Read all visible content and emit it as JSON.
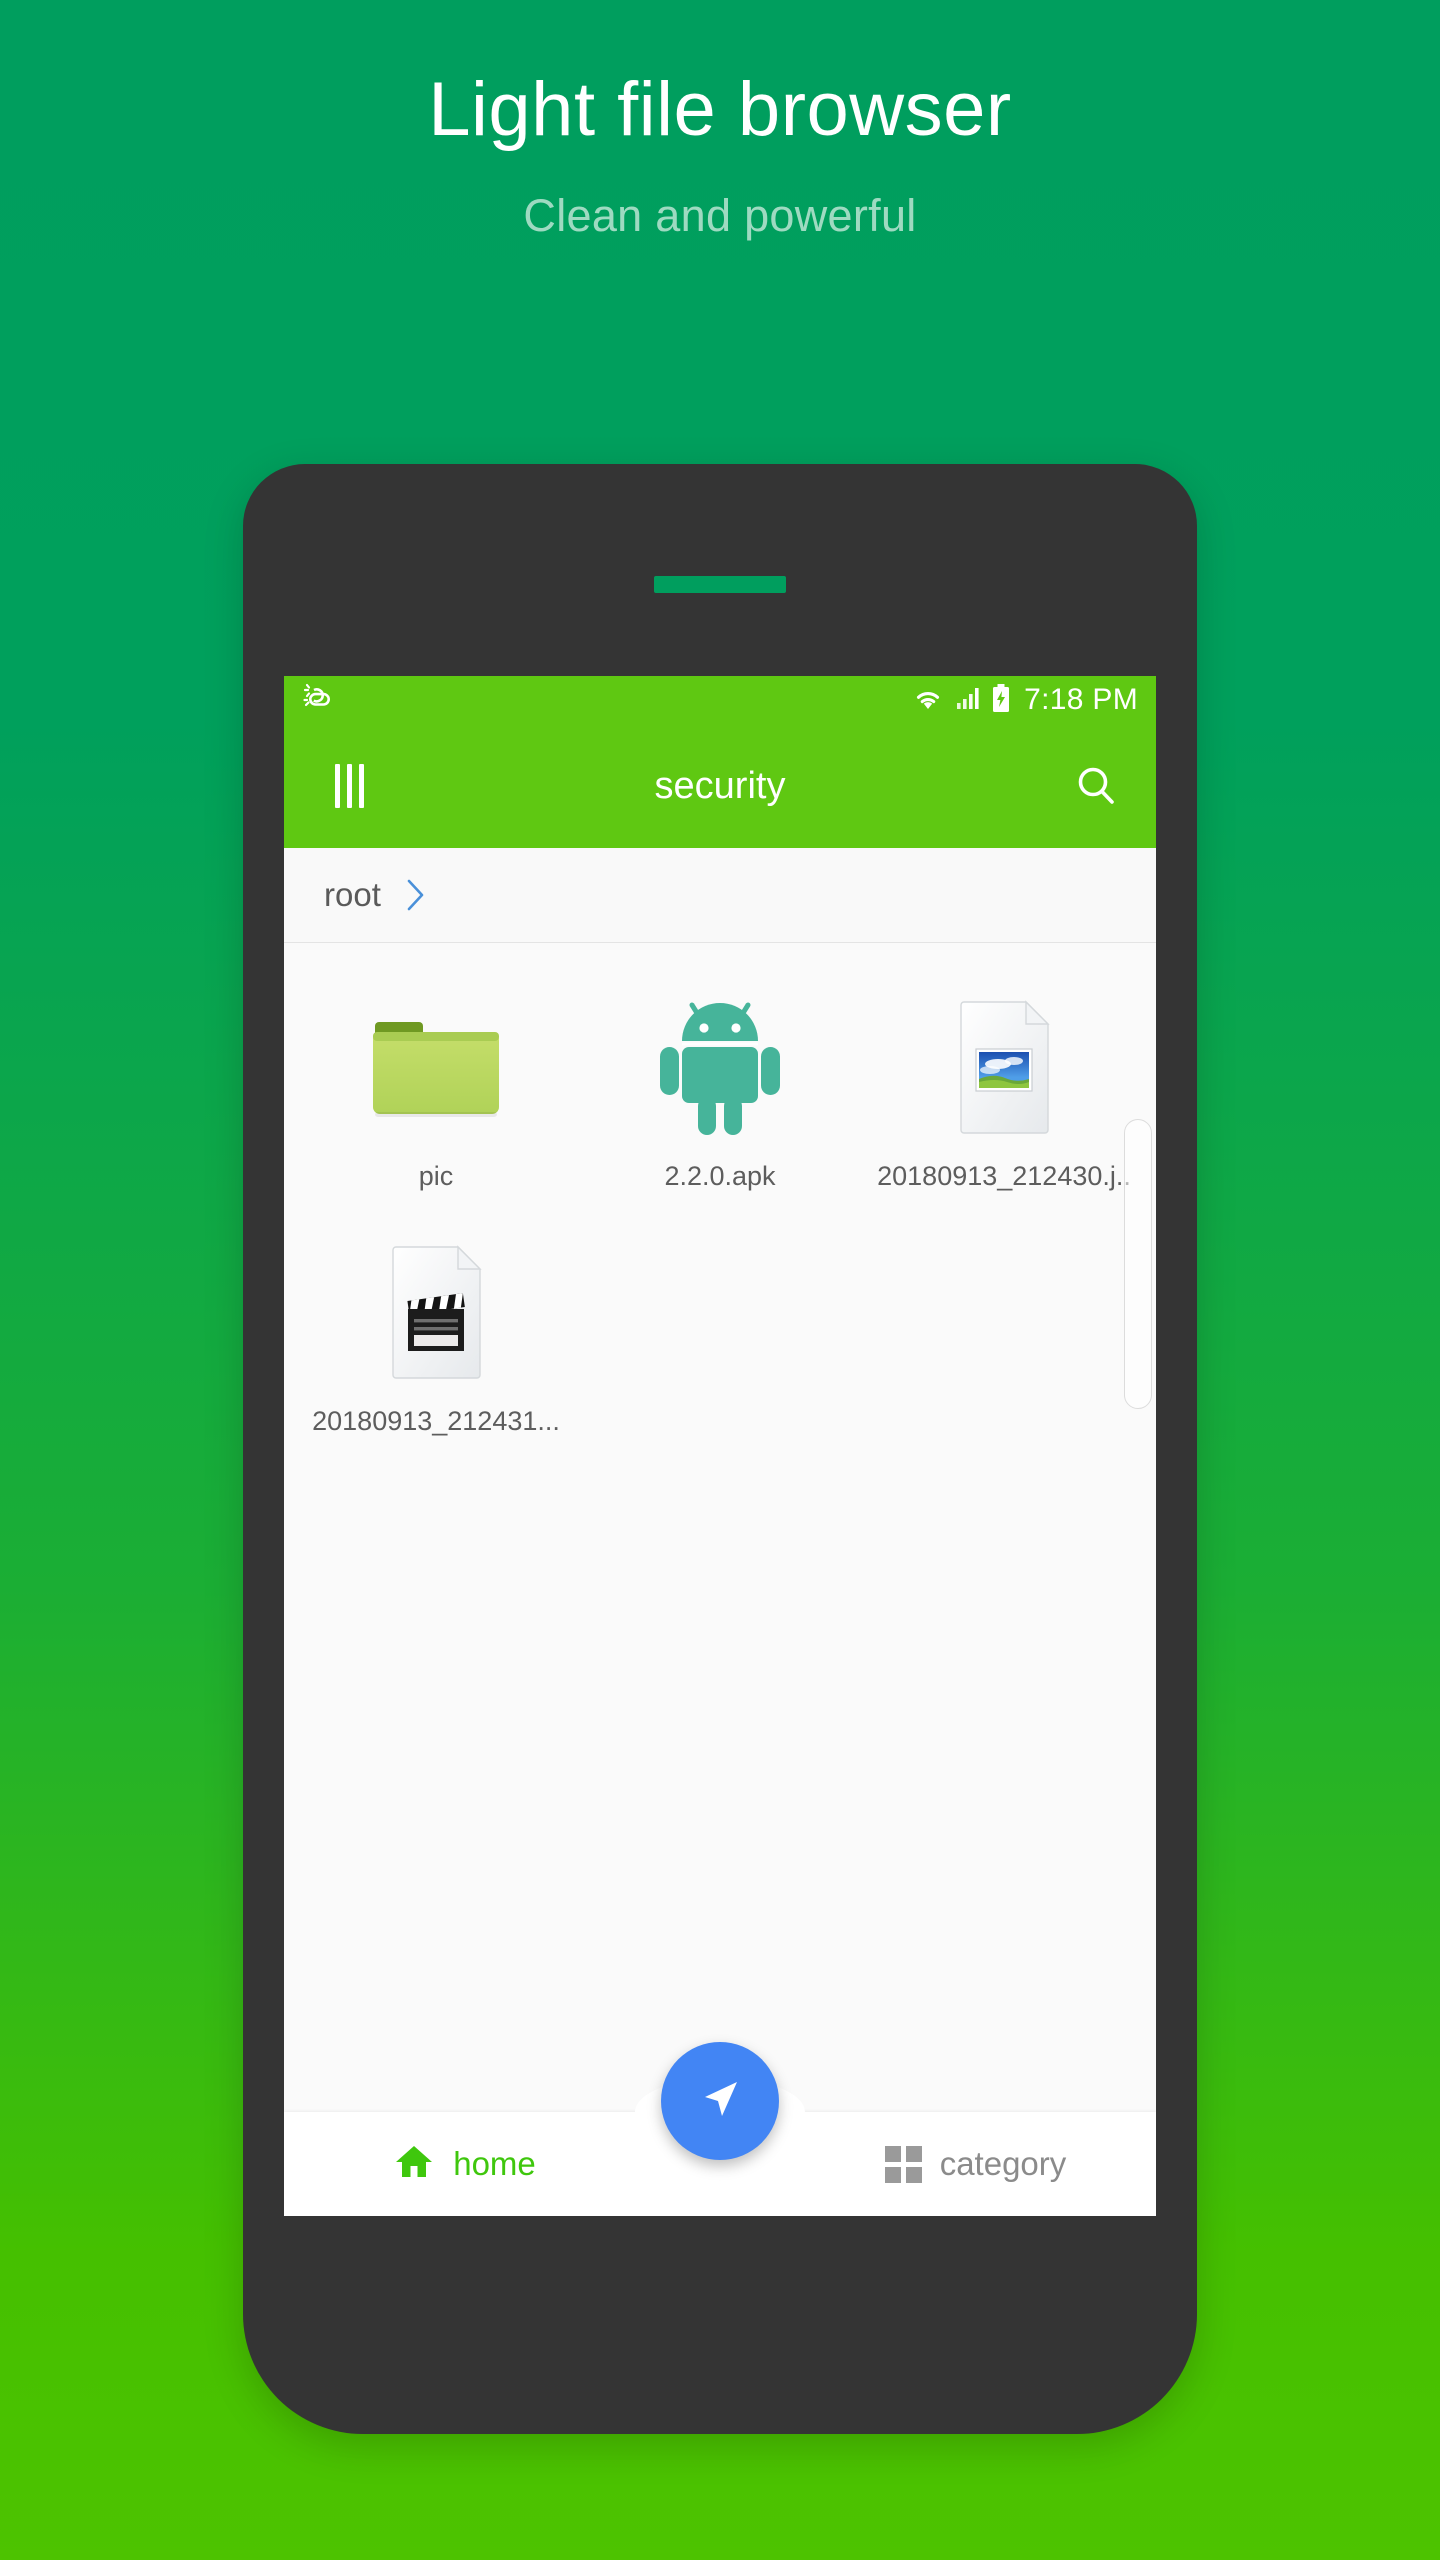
{
  "promo": {
    "title": "Light file browser",
    "subtitle": "Clean and powerful",
    "bg_top_color": "#009E5E",
    "bg_bottom_color": "#4DC300"
  },
  "phone": {
    "frame_color": "#343434",
    "speaker_color": "#009E5E"
  },
  "status_bar": {
    "weather_icon": "sun-cloud-icon",
    "wifi_icon": "wifi-icon",
    "signal_icon": "signal-bars-icon",
    "battery_icon": "battery-charging-icon",
    "time": "7:18 PM",
    "background_color": "#5FC812"
  },
  "app_bar": {
    "menu_icon": "menu-bars-icon",
    "title": "security",
    "search_icon": "search-icon",
    "background_color": "#5FC812",
    "text_color": "#FFFFFF"
  },
  "breadcrumb": {
    "root_label": "root",
    "chevron_icon": "chevron-right-icon",
    "chevron_color": "#4A90D9"
  },
  "files": [
    {
      "name": "pic",
      "icon": "folder-icon",
      "type": "folder"
    },
    {
      "name": "2.2.0.apk",
      "icon": "android-apk-icon",
      "type": "apk"
    },
    {
      "name": "20180913_212430.j..",
      "icon": "image-file-icon",
      "type": "image"
    },
    {
      "name": "20180913_212431...",
      "icon": "video-file-icon",
      "type": "video"
    }
  ],
  "bottom_nav": {
    "home_label": "home",
    "home_icon": "home-icon",
    "home_color": "#3FC70D",
    "category_label": "category",
    "category_icon": "grid-icon",
    "category_color": "#8B8B8B",
    "fab_icon": "navigation-arrow-icon",
    "fab_color": "#4285F4"
  }
}
